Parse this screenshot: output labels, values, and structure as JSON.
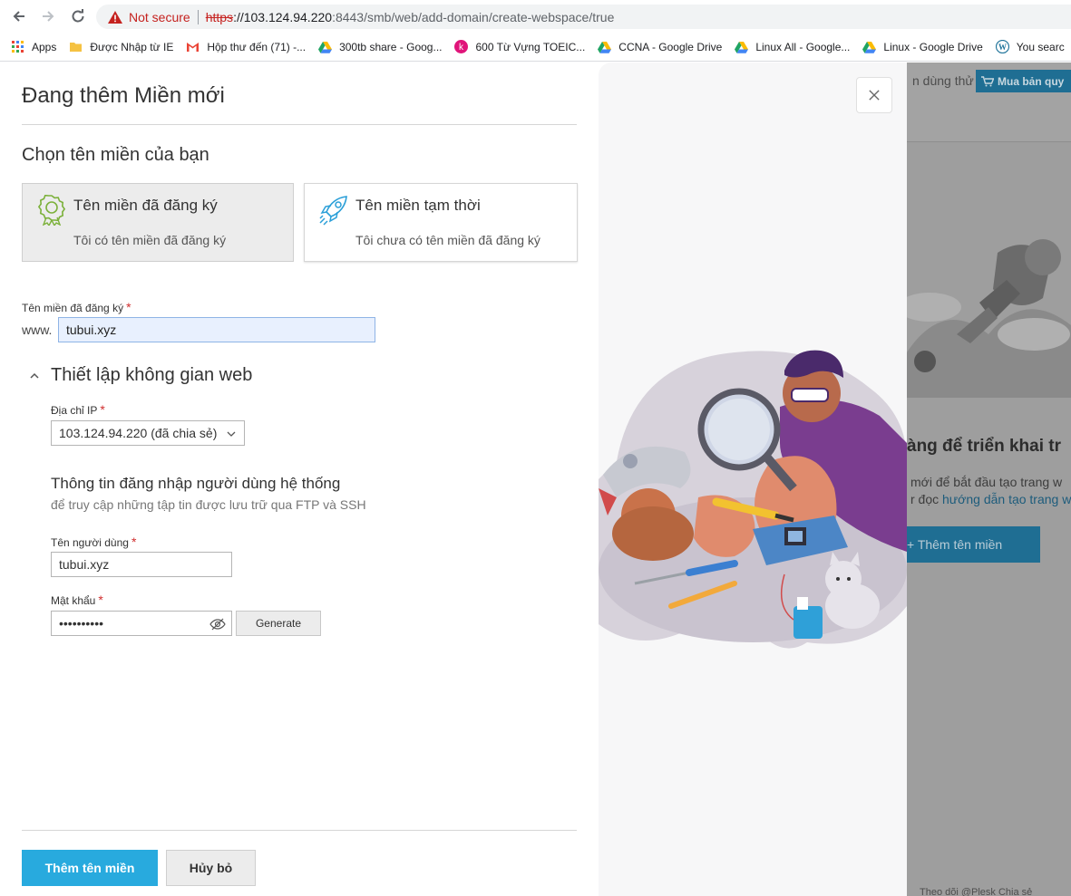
{
  "browser": {
    "not_secure": "Not secure",
    "url_https": "https",
    "url_host": "://103.124.94.220",
    "url_path": ":8443/smb/web/add-domain/create-webspace/true",
    "bookmarks": [
      {
        "label": "Apps",
        "icon": "apps-grid-icon"
      },
      {
        "label": "Được Nhập từ IE",
        "icon": "folder-icon"
      },
      {
        "label": "Hộp thư đến (71) -...",
        "icon": "gmail-icon"
      },
      {
        "label": "300tb share - Goog...",
        "icon": "google-drive-icon"
      },
      {
        "label": "600 Từ Vựng TOEIC...",
        "icon": "k-site-icon"
      },
      {
        "label": "CCNA - Google Drive",
        "icon": "google-drive-icon"
      },
      {
        "label": "Linux All - Google...",
        "icon": "google-drive-icon"
      },
      {
        "label": "Linux - Google Drive",
        "icon": "google-drive-icon"
      },
      {
        "label": "You searc",
        "icon": "wordpress-icon"
      }
    ]
  },
  "modal": {
    "title": "Đang thêm Miền mới",
    "subtitle": "Chọn tên miền của bạn",
    "options": [
      {
        "title": "Tên miền đã đăng ký",
        "desc": "Tôi có tên miền đã đăng ký",
        "selected": true
      },
      {
        "title": "Tên miền tạm thời",
        "desc": "Tôi chưa có tên miền đã đăng ký",
        "selected": false
      }
    ],
    "domain_label": "Tên miền đã đăng ký",
    "required_mark": "*",
    "www_prefix": "www.",
    "domain_value": "tubui.xyz",
    "webspace_title": "Thiết lập không gian web",
    "ip_label": "Địa chỉ IP",
    "ip_value": "103.124.94.220 (đã chia sẻ)",
    "login_title": "Thông tin đăng nhập người dùng hệ thống",
    "login_subtitle": "để truy cập những tập tin được lưu trữ qua FTP và SSH",
    "username_label": "Tên người dùng",
    "username_value": "tubui.xyz",
    "password_label": "Mật khẩu",
    "password_value": "••••••••••",
    "generate_label": "Generate",
    "submit_label": "Thêm tên miền",
    "cancel_label": "Hủy bỏ"
  },
  "background_page": {
    "trial_text": "n dùng thử",
    "buy_label": "Mua bản quy",
    "heading": "àng để triển khai tr",
    "text1": "mới để bắt đầu tạo trang w",
    "text2_prefix": "r đọc ",
    "text2_link": "hướng dẫn tạo trang w",
    "button_label": "+ Thêm tên miền",
    "footer": "Theo dõi @Plesk      Chia sẻ"
  },
  "colors": {
    "primary": "#28aade",
    "required": "#d02e2e",
    "warning": "#c5221f"
  }
}
